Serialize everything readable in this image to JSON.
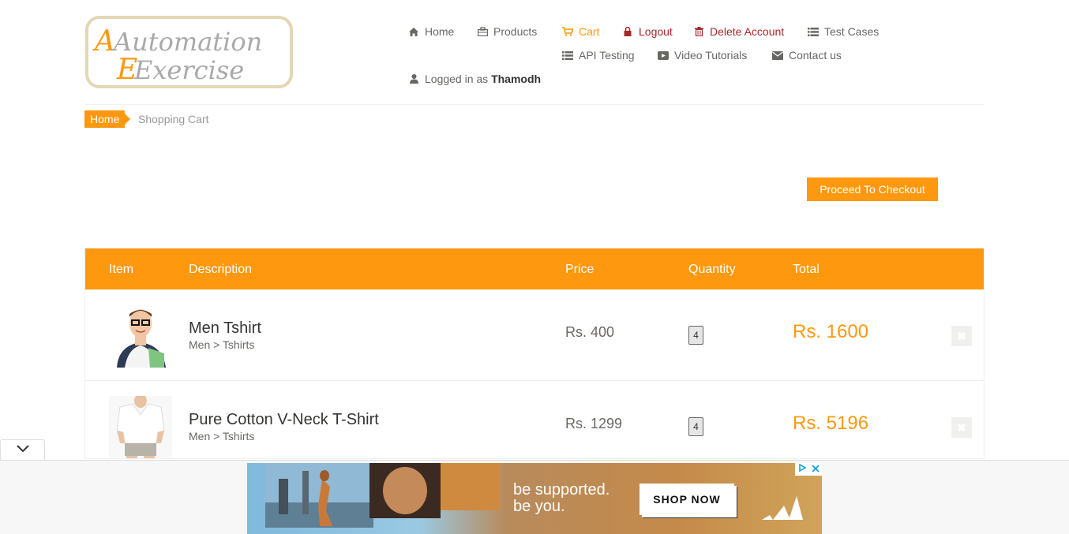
{
  "logo": {
    "line1": "Automation",
    "line2": "Exercise"
  },
  "nav": {
    "home": "Home",
    "products": "Products",
    "cart": "Cart",
    "logout": "Logout",
    "delete_account": "Delete Account",
    "test_cases": "Test Cases",
    "api_testing": "API Testing",
    "video_tutorials": "Video Tutorials",
    "contact_us": "Contact us",
    "logged_in_prefix": "Logged in as",
    "username": "Thamodh"
  },
  "breadcrumb": {
    "home": "Home",
    "current": "Shopping Cart"
  },
  "checkout_button": "Proceed To Checkout",
  "table": {
    "headers": {
      "item": "Item",
      "description": "Description",
      "price": "Price",
      "quantity": "Quantity",
      "total": "Total"
    },
    "rows": [
      {
        "name": "Men Tshirt",
        "category": "Men > Tshirts",
        "price": "Rs. 400",
        "quantity": "4",
        "total": "Rs. 1600",
        "delete": "✖"
      },
      {
        "name": "Pure Cotton V-Neck T-Shirt",
        "category": "Men > Tshirts",
        "price": "Rs. 1299",
        "quantity": "4",
        "total": "Rs. 5196",
        "delete": "✖"
      }
    ]
  },
  "ad": {
    "line1": "be supported.",
    "line2": "be you.",
    "button": "SHOP NOW"
  },
  "colors": {
    "accent": "#fe980f",
    "danger": "#a52a2a",
    "text": "#696763"
  }
}
